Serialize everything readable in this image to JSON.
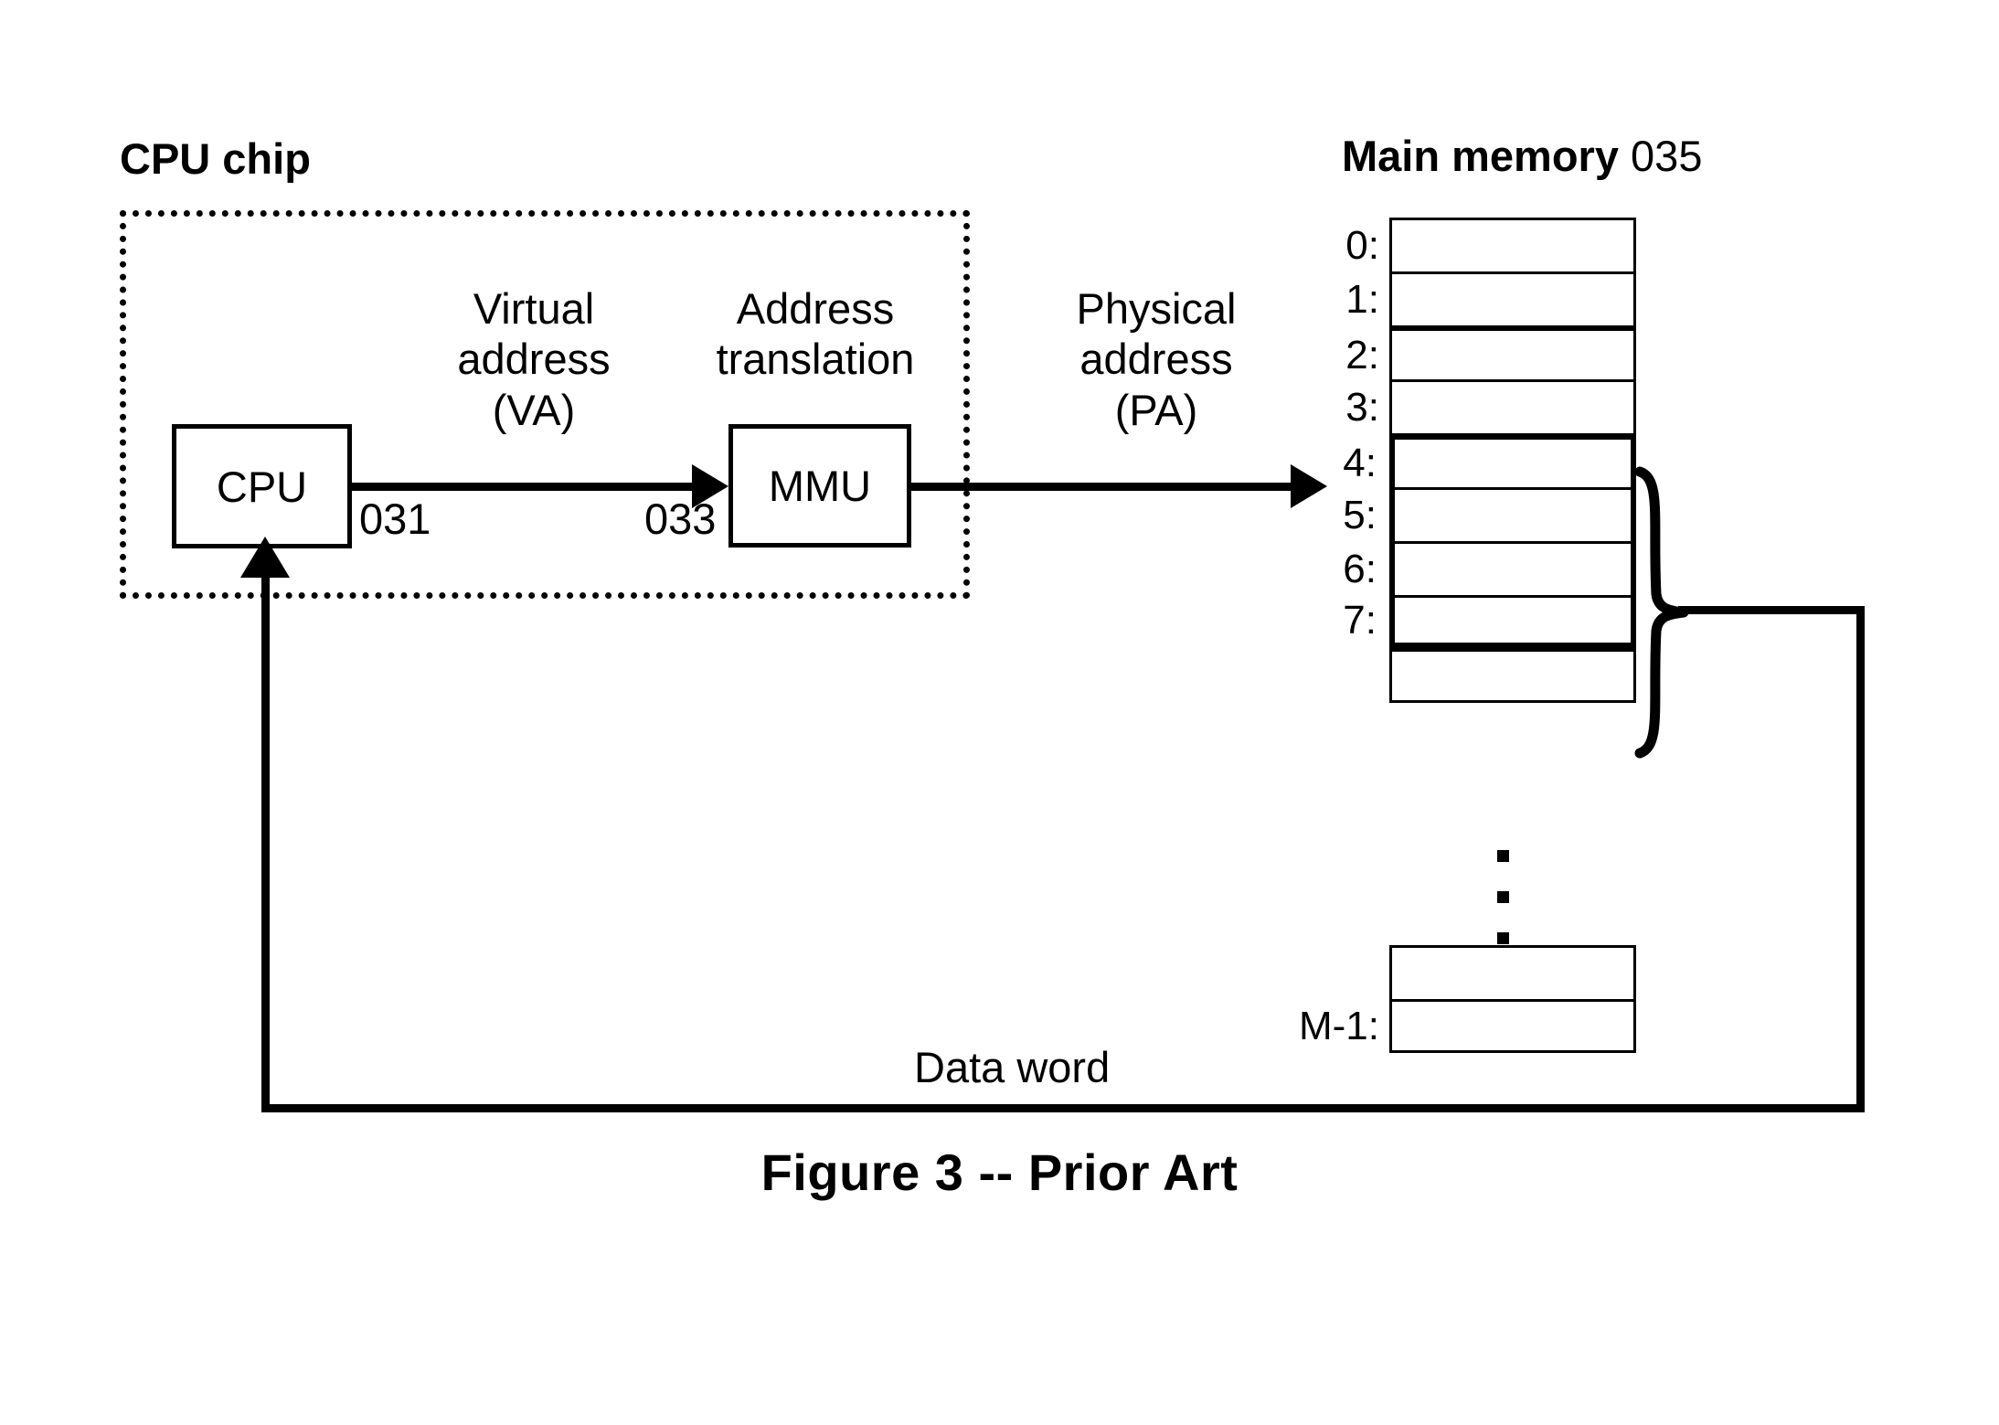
{
  "figure": {
    "caption": "Figure 3 -- Prior Art"
  },
  "cpu_chip": {
    "title": "CPU chip",
    "cpu_box_label": "CPU",
    "cpu_ref_number": "031",
    "mmu_box_label": "MMU",
    "mmu_ref_number": "033",
    "virtual_address_label": "Virtual\naddress\n(VA)",
    "address_translation_label": "Address\ntranslation"
  },
  "bus": {
    "physical_address_label": "Physical\naddress\n(PA)",
    "data_word_label": "Data word"
  },
  "main_memory": {
    "title": "Main memory",
    "ref_number": "035",
    "upper_rows": [
      {
        "label": "0:"
      },
      {
        "label": "1:"
      },
      {
        "label": "2:"
      },
      {
        "label": "3:"
      },
      {
        "label": "4:"
      },
      {
        "label": "5:"
      },
      {
        "label": "6:"
      },
      {
        "label": "7:"
      },
      {
        "label": ""
      }
    ],
    "ellipsis": "⋮",
    "lower_rows": [
      {
        "label": ""
      },
      {
        "label": "M-1:"
      }
    ],
    "highlighted_range": "4-7"
  },
  "colors": {
    "stroke": "#000000",
    "background": "#ffffff"
  }
}
